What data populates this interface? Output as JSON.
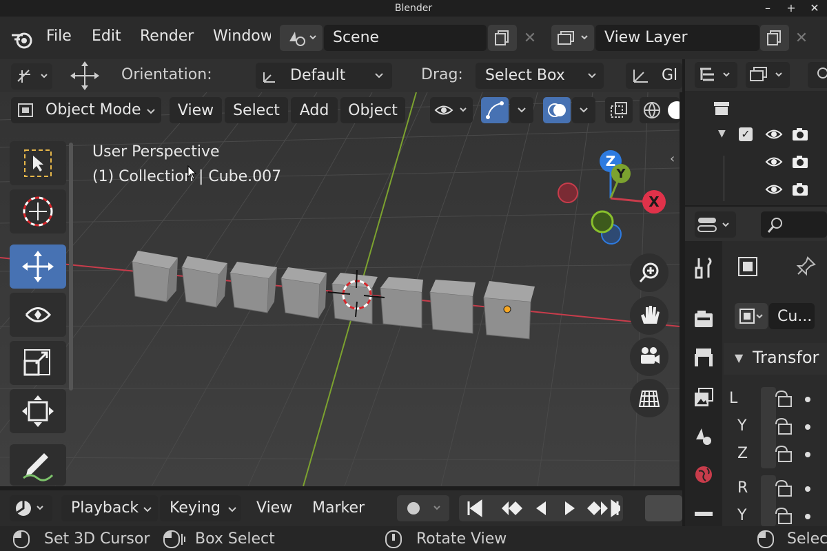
{
  "window": {
    "title": "Blender"
  },
  "menubar": {
    "items": [
      "File",
      "Edit",
      "Render",
      "Window"
    ],
    "scene": "Scene",
    "view_layer": "View Layer"
  },
  "tool_header": {
    "orientation_label": "Orientation:",
    "orientation_value": "Default",
    "drag_label": "Drag:",
    "drag_value": "Select Box",
    "global_partial": "Gl"
  },
  "viewport_header": {
    "mode": "Object Mode",
    "menus": [
      "View",
      "Select",
      "Add",
      "Object"
    ]
  },
  "viewport": {
    "perspective": "User Perspective",
    "collection_info": "(1) Collection | Cube.007",
    "gizmo": {
      "z": "Z",
      "y": "Y",
      "x": "X"
    },
    "colors": {
      "x_axis": "#c83c4b",
      "y_axis": "#7ca22f",
      "z_axis": "#2e7be0",
      "background": "#3b3b3b"
    }
  },
  "timeline": {
    "menus": [
      "Playback",
      "Keying",
      "View",
      "Marker"
    ]
  },
  "statusbar": {
    "left": "Set 3D Cursor",
    "mid1": "Box Select",
    "mid2": "Rotate View",
    "right": "Selec"
  },
  "properties": {
    "object_name": "Cu...",
    "panel_title": "Transfor",
    "location_rows": [
      "L",
      "Y",
      "Z"
    ],
    "rotation_rows": [
      "R",
      "Y"
    ]
  }
}
